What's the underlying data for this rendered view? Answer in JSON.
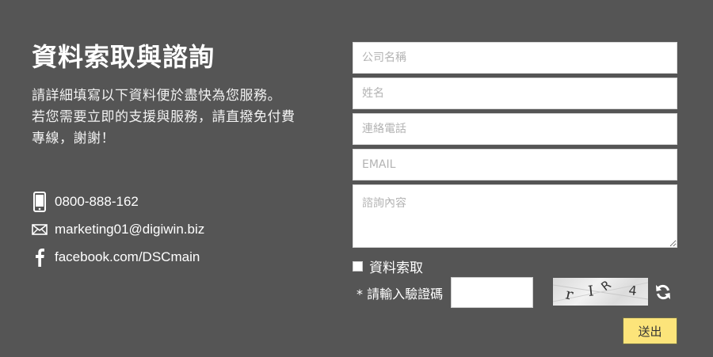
{
  "section": {
    "title": "資料索取與諮詢",
    "description_line1": "請詳細填寫以下資料便於盡快為您服務。",
    "description_line2": "若您需要立即的支援與服務，請直撥免付費",
    "description_line3": "專線，謝謝！"
  },
  "contacts": {
    "phone": {
      "icon": "phone-icon",
      "text": "0800-888-162"
    },
    "email": {
      "icon": "mail-icon",
      "text": "marketing01@digiwin.biz"
    },
    "facebook": {
      "icon": "facebook-icon",
      "text": "facebook.com/DSCmain"
    }
  },
  "form": {
    "company": {
      "placeholder": "公司名稱",
      "value": ""
    },
    "name": {
      "placeholder": "姓名",
      "value": ""
    },
    "phone": {
      "placeholder": "連絡電話",
      "value": ""
    },
    "email": {
      "placeholder": "EMAIL",
      "value": ""
    },
    "inquiry": {
      "placeholder": "諮詢內容",
      "value": ""
    },
    "request_materials_label": "資料索取",
    "request_materials_checked": false,
    "captcha_label": "* 請輸入驗證碼",
    "captcha_input_value": "",
    "captcha_chars": [
      "r",
      "I",
      "R",
      "4"
    ],
    "submit_label": "送出"
  },
  "colors": {
    "background": "#555555",
    "text": "#ffffff",
    "submit_bg": "#fce47a"
  }
}
